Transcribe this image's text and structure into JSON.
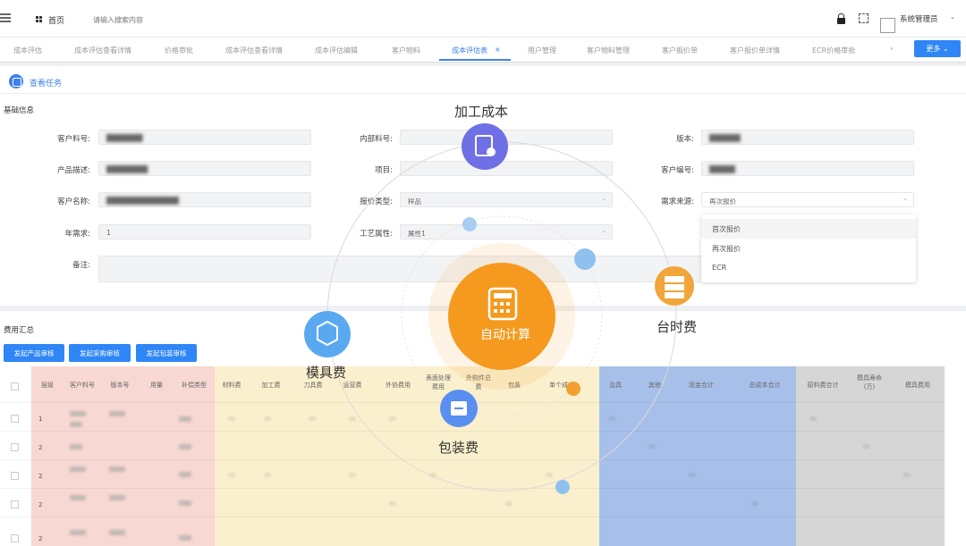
{
  "topbar": {
    "home_label": "首页",
    "search_placeholder": "请输入搜索内容",
    "user_name": "系统管理员",
    "caret": "⌄"
  },
  "tabs": [
    {
      "label": "成本评估"
    },
    {
      "label": "成本评估查看详情"
    },
    {
      "label": "价格审批"
    },
    {
      "label": "成本评估查看详情"
    },
    {
      "label": "成本评估编辑"
    },
    {
      "label": "客户物料"
    },
    {
      "label": "成本评估表"
    },
    {
      "label": "用户管理"
    },
    {
      "label": "客户物料管理"
    },
    {
      "label": "客户报价单"
    },
    {
      "label": "客户报价单详情"
    },
    {
      "label": "ECR价格审批"
    }
  ],
  "tab_close": "×",
  "tab_next": "›",
  "more_button": "更多 ⌄",
  "task_link": "查看任务",
  "basic_info": {
    "title": "基础信息",
    "labels": {
      "cust_material": "客户料号:",
      "inner_material": "内部料号:",
      "version": "版本:",
      "product_desc": "产品描述:",
      "project": "项目:",
      "cust_code": "客户编号:",
      "cust_name": "客户名称:",
      "quote_type": "报价类型:",
      "demand_src": "需求来源:",
      "annual_demand": "年需求:",
      "craft": "工艺属性:",
      "remark": "备注:"
    },
    "values": {
      "cust_material": "███████",
      "version": "██████",
      "product_desc": "████████",
      "cust_code": "█████",
      "cust_name": "██████████████",
      "quote_type": "样品",
      "demand_src": "再次报价",
      "annual_demand": "1",
      "craft": "属性1"
    }
  },
  "dropdown": {
    "options": [
      "首次报价",
      "再次报价",
      "ECR"
    ]
  },
  "cost_summary": {
    "title": "费用汇总",
    "buttons": [
      "发起产品审核",
      "发起采购审核",
      "发起包装审核"
    ],
    "columns": [
      "层级",
      "客户料号",
      "版本号",
      "用量",
      "补偿类型",
      "材料费",
      "加工费",
      "刀具费",
      "运营费",
      "外协费用",
      "表面处理\n费用",
      "外购件总\n费",
      "包装",
      "单个成本",
      "治具",
      "其他",
      "现金合计",
      "总成本合计",
      "原料费合计",
      "模具寿命\n(万)",
      "模具费用"
    ],
    "rows": [
      {
        "level": "1"
      },
      {
        "level": "2"
      },
      {
        "level": "2"
      },
      {
        "level": "2"
      },
      {
        "level": "2"
      }
    ]
  },
  "overlay": {
    "center_label": "自动计算",
    "labels": {
      "processing": "加工成本",
      "machine_hour": "台时费",
      "mold": "模具费",
      "packaging": "包装费"
    }
  },
  "colors": {
    "accent": "#2f86f6",
    "col_pink": "#f8d8d2",
    "col_yellow": "#fbf0cd",
    "col_blue": "#a7c0ea",
    "col_gray": "#d6d6d6",
    "center_orange": "#f59a1e",
    "icon_purple": "#6f6fe6",
    "icon_blue": "#5aa9f0",
    "icon_orange": "#f1a53a"
  }
}
